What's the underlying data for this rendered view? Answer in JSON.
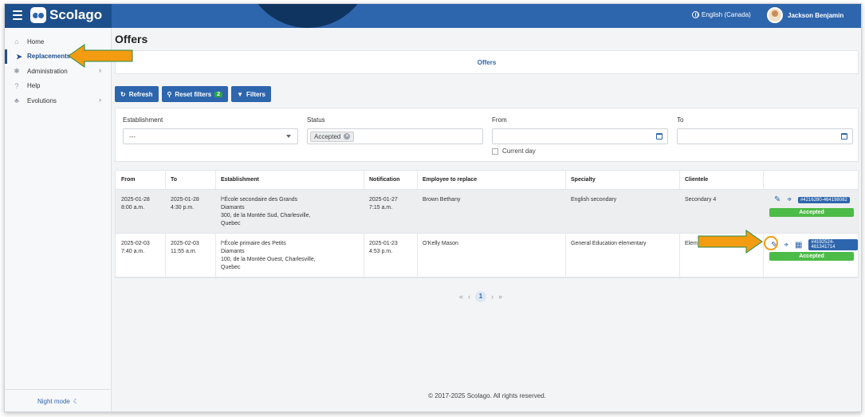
{
  "app": {
    "logo": "Scolago",
    "language": "English (Canada)",
    "user": "Jackson Benjamin"
  },
  "sidebar": {
    "items": [
      {
        "label": "Home",
        "icon": "home-icon",
        "active": false
      },
      {
        "label": "Replacements",
        "icon": "paper-plane-icon",
        "active": true
      },
      {
        "label": "Administration",
        "icon": "gear-icon",
        "active": false,
        "has_children": true
      },
      {
        "label": "Help",
        "icon": "question-icon",
        "active": false
      },
      {
        "label": "Evolutions",
        "icon": "sprout-icon",
        "active": false,
        "has_children": true
      }
    ],
    "night_mode": "Night mode"
  },
  "page": {
    "title": "Offers",
    "tab": "Offers"
  },
  "toolbar": {
    "refresh": "Refresh",
    "reset_filters": "Reset filters",
    "reset_count": "2",
    "filters": "Filters"
  },
  "filters": {
    "establishment_label": "Establishment",
    "establishment_value": "---",
    "status_label": "Status",
    "status_chip": "Accepted",
    "from_label": "From",
    "to_label": "To",
    "current_day": "Current day"
  },
  "table": {
    "headers": [
      "From",
      "To",
      "Establishment",
      "Notification",
      "Employee to replace",
      "Specialty",
      "Clientele",
      ""
    ],
    "rows": [
      {
        "from_date": "2025-01-28",
        "from_time": "8:00 a.m.",
        "to_date": "2025-01-28",
        "to_time": "4:30 p.m.",
        "establishment": [
          "l*École secondaire des Grands",
          "Diamants",
          "300, de la Montée Sud, Charlesville,",
          "Quebec"
        ],
        "notif_date": "2025-01-27",
        "notif_time": "7:15 a.m.",
        "employee": "Brown Bethany",
        "specialty": "English secondary",
        "clientele": "Secondary 4",
        "ref": "#4216280-464198082",
        "status": "Accepted"
      },
      {
        "from_date": "2025-02-03",
        "from_time": "7:40 a.m.",
        "to_date": "2025-02-03",
        "to_time": "11:55 a.m.",
        "establishment": [
          "l*École primaire des Petits",
          "Diamants",
          "100, de la Montée Ouest, Charlesville,",
          "Quebec"
        ],
        "notif_date": "2025-01-23",
        "notif_time": "4:53 p.m.",
        "employee": "O'Kelly Mason",
        "specialty": "General Education elementary",
        "clientele": "Elem",
        "ref": "#4192524-461341714",
        "status": "Accepted"
      }
    ]
  },
  "pagination": {
    "current": "1"
  },
  "footer": "© 2017-2025 Scolago. All rights reserved.",
  "colors": {
    "primary": "#2e66ad",
    "accepted": "#4cbb47",
    "annotation": "#f39c12"
  }
}
